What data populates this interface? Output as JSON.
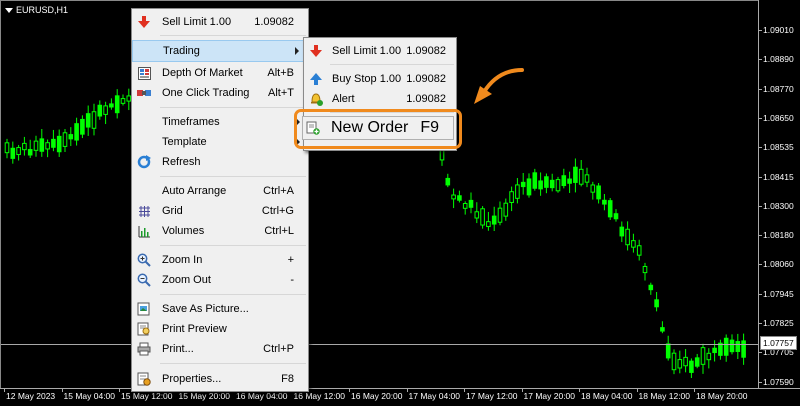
{
  "chart": {
    "symbol": "EURUSD,H1",
    "current_price": "1.07757",
    "price_labels": [
      "1.09010",
      "1.08890",
      "1.08770",
      "1.08650",
      "1.08535",
      "1.08415",
      "1.08300",
      "1.08180",
      "1.08060",
      "1.07945",
      "1.07825",
      "1.07705",
      "1.07590"
    ],
    "time_labels": [
      "12 May 2023",
      "15 May 04:00",
      "15 May 12:00",
      "15 May 20:00",
      "16 May 04:00",
      "16 May 12:00",
      "16 May 20:00",
      "17 May 04:00",
      "17 May 12:00",
      "17 May 20:00",
      "18 May 04:00",
      "18 May 12:00",
      "18 May 20:00"
    ],
    "bull_color": "#00ff00",
    "bear_color": "#00ff00"
  },
  "main_menu": {
    "items": [
      {
        "label": "Sell Limit 1.00",
        "shortcut": "1.09082",
        "icon": "sell-limit-icon"
      },
      {
        "label": "Trading",
        "shortcut": "",
        "icon": "",
        "submenu": true
      },
      {
        "label": "Depth Of Market",
        "shortcut": "Alt+B",
        "icon": "depth-of-market-icon"
      },
      {
        "label": "One Click Trading",
        "shortcut": "Alt+T",
        "icon": "one-click-trading-icon"
      },
      {
        "label": "Timeframes",
        "shortcut": "",
        "icon": ""
      },
      {
        "label": "Template",
        "shortcut": "",
        "icon": ""
      },
      {
        "label": "Refresh",
        "shortcut": "",
        "icon": "refresh-icon"
      },
      {
        "label": "Auto Arrange",
        "shortcut": "Ctrl+A",
        "icon": ""
      },
      {
        "label": "Grid",
        "shortcut": "Ctrl+G",
        "icon": "grid-icon"
      },
      {
        "label": "Volumes",
        "shortcut": "Ctrl+L",
        "icon": "volumes-icon"
      },
      {
        "label": "Zoom In",
        "shortcut": "+",
        "icon": "zoom-in-icon"
      },
      {
        "label": "Zoom Out",
        "shortcut": "-",
        "icon": "zoom-out-icon"
      },
      {
        "label": "Save As Picture...",
        "shortcut": "",
        "icon": "save-picture-icon"
      },
      {
        "label": "Print Preview",
        "shortcut": "",
        "icon": "print-preview-icon"
      },
      {
        "label": "Print...",
        "shortcut": "Ctrl+P",
        "icon": "print-icon"
      },
      {
        "label": "Properties...",
        "shortcut": "F8",
        "icon": "properties-icon"
      }
    ]
  },
  "sub_menu": {
    "items": [
      {
        "label": "Sell Limit 1.00",
        "value": "1.09082",
        "icon": "sell-limit-icon"
      },
      {
        "label": "Buy Stop 1.00",
        "value": "1.09082",
        "icon": "buy-stop-icon"
      },
      {
        "label": "Alert",
        "value": "1.09082",
        "icon": "alert-bell-icon"
      },
      {
        "label": "New Order",
        "value": "F9",
        "icon": "new-order-icon"
      }
    ]
  },
  "annotation": {
    "color": "#f08a1d"
  }
}
